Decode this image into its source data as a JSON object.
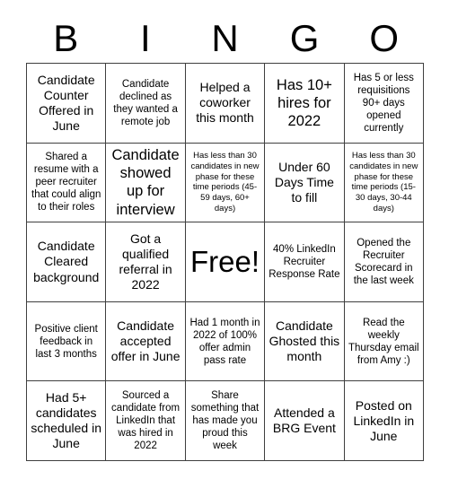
{
  "header": {
    "letters": [
      "B",
      "I",
      "N",
      "G",
      "O"
    ]
  },
  "grid": {
    "rows": 5,
    "columns": 5,
    "border_color": "#3f3f3f",
    "background_color": "#ffffff",
    "text_color": "#000000",
    "cells": [
      {
        "text": "Candidate Counter Offered in June",
        "size": "md"
      },
      {
        "text": "Candidate declined as they wanted a remote job",
        "size": "sm"
      },
      {
        "text": "Helped a coworker this month",
        "size": "md"
      },
      {
        "text": "Has 10+ hires for 2022",
        "size": "lg"
      },
      {
        "text": "Has 5 or less requisitions 90+ days opened currently",
        "size": "sm"
      },
      {
        "text": "Shared a resume with a peer recruiter that could align to their roles",
        "size": "sm"
      },
      {
        "text": "Candidate showed up for interview",
        "size": "lg"
      },
      {
        "text": "Has less than 30 candidates in new phase for these time periods (45-59 days, 60+ days)",
        "size": "xs"
      },
      {
        "text": "Under 60 Days Time to fill",
        "size": "md"
      },
      {
        "text": "Has less than 30 candidates in new phase for these time periods (15-30 days, 30-44 days)",
        "size": "xs"
      },
      {
        "text": "Candidate Cleared background",
        "size": "md"
      },
      {
        "text": "Got a qualified referral in 2022",
        "size": "md"
      },
      {
        "text": "Free!",
        "size": "free"
      },
      {
        "text": "40% LinkedIn Recruiter Response Rate",
        "size": "sm"
      },
      {
        "text": "Opened the Recruiter Scorecard in the last week",
        "size": "sm"
      },
      {
        "text": "Positive client feedback in last 3 months",
        "size": "sm"
      },
      {
        "text": "Candidate accepted offer in June",
        "size": "md"
      },
      {
        "text": "Had 1 month in 2022 of 100% offer admin pass rate",
        "size": "sm"
      },
      {
        "text": "Candidate Ghosted this month",
        "size": "md"
      },
      {
        "text": "Read the weekly Thursday email from Amy :)",
        "size": "sm"
      },
      {
        "text": "Had 5+ candidates scheduled in June",
        "size": "md"
      },
      {
        "text": "Sourced a candidate from LinkedIn that was hired in 2022",
        "size": "sm"
      },
      {
        "text": "Share something that has made you proud this week",
        "size": "sm"
      },
      {
        "text": "Attended a BRG Event",
        "size": "md"
      },
      {
        "text": "Posted on LinkedIn in June",
        "size": "md"
      }
    ]
  }
}
